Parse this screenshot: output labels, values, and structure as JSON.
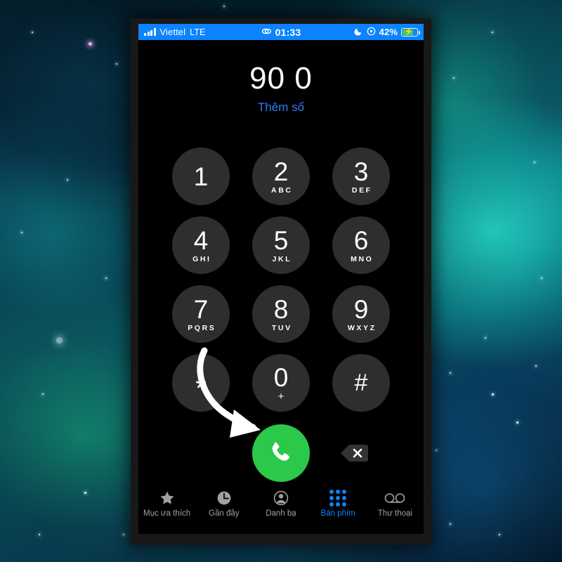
{
  "wallpaper": {
    "description": "teal-cyan nebula space wallpaper with stars",
    "colors": {
      "cyan": "#1ecfc0",
      "teal": "#0a5f6b",
      "deep_blue": "#0a4f74",
      "dark": "#05202c"
    }
  },
  "statusbar": {
    "signal_icon": "signal-bars-icon",
    "carrier": "Viettel",
    "network": "LTE",
    "link_icon": "link-icon",
    "time": "01:33",
    "dnd_icon": "moon-icon",
    "alarm_icon": "alarm-clock-icon",
    "battery_percent": "42%",
    "battery_level": 42,
    "charging": true,
    "bolt_icon": "charging-bolt-icon",
    "background_color": "#0b84fe"
  },
  "display": {
    "number": "90 0",
    "add_number_label": "Thêm số",
    "add_number_color": "#2f7dfa"
  },
  "keypad": {
    "keys": [
      {
        "digit": "1",
        "letters": ""
      },
      {
        "digit": "2",
        "letters": "ABC"
      },
      {
        "digit": "3",
        "letters": "DEF"
      },
      {
        "digit": "4",
        "letters": "GHI"
      },
      {
        "digit": "5",
        "letters": "JKL"
      },
      {
        "digit": "6",
        "letters": "MNO"
      },
      {
        "digit": "7",
        "letters": "PQRS"
      },
      {
        "digit": "8",
        "letters": "TUV"
      },
      {
        "digit": "9",
        "letters": "WXYZ"
      },
      {
        "digit": "*",
        "letters": ""
      },
      {
        "digit": "0",
        "letters": "+"
      },
      {
        "digit": "#",
        "letters": ""
      }
    ],
    "key_color": "#2e2e2e"
  },
  "actions": {
    "call_button": {
      "icon": "phone-handset-icon",
      "color": "#2bc84a"
    },
    "delete_button": {
      "icon": "backspace-delete-icon"
    }
  },
  "annotation": {
    "arrow": {
      "icon": "curved-arrow-annotation",
      "color": "#ffffff",
      "points_to": "call-button"
    }
  },
  "tabbar": {
    "items": [
      {
        "label": "Mục ưa thích",
        "icon": "star-icon",
        "active": false
      },
      {
        "label": "Gần đây",
        "icon": "clock-icon",
        "active": false
      },
      {
        "label": "Danh bạ",
        "icon": "person-circle-icon",
        "active": false
      },
      {
        "label": "Bàn phím",
        "icon": "keypad-dots-icon",
        "active": true
      },
      {
        "label": "Thư thoại",
        "icon": "voicemail-icon",
        "active": false
      }
    ],
    "active_color": "#0a84ff",
    "inactive_color": "#a0a0a0"
  }
}
